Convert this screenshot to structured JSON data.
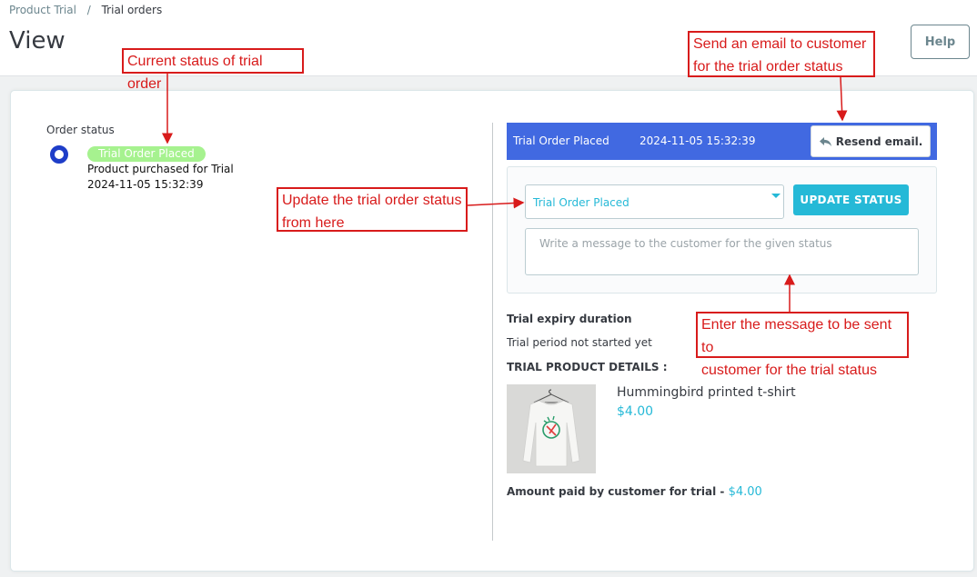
{
  "breadcrumb": {
    "parent": "Product Trial",
    "separator": "/",
    "current": "Trial orders"
  },
  "page_title": "View",
  "help_button": "Help",
  "timeline": {
    "label": "Order status",
    "badge": "Trial Order Placed",
    "description": "Product purchased for Trial",
    "date": "2024-11-05 15:32:39"
  },
  "status_bar": {
    "name": "Trial Order Placed",
    "date": "2024-11-05 15:32:39",
    "resend_label": "Resend email."
  },
  "update_form": {
    "selected_status": "Trial Order Placed",
    "update_label": "UPDATE STATUS",
    "message_placeholder": "Write a message to the customer for the given status"
  },
  "trial": {
    "expiry_title": "Trial expiry duration",
    "expiry_text": "Trial period not started yet",
    "details_title": "TRIAL PRODUCT DETAILS :",
    "product_name": "Hummingbird printed t-shirt",
    "product_price": "$4.00",
    "amount_label": "Amount paid by customer for trial - ",
    "amount_value": "$4.00"
  },
  "annotations": {
    "current_status": "Current status of trial order",
    "send_email_1": "Send an email to customer",
    "send_email_2": "for the trial order status",
    "update_status_1": "Update the trial order status",
    "update_status_2": "from here",
    "enter_message_1": "Enter the message to be sent to",
    "enter_message_2": "customer for the trial status"
  },
  "colors": {
    "accent": "#25b9d7",
    "status_bar": "#4169e1",
    "badge": "#a6f28f",
    "annotation": "#d81b1b",
    "timeline_dot": "#1e3dc8"
  }
}
